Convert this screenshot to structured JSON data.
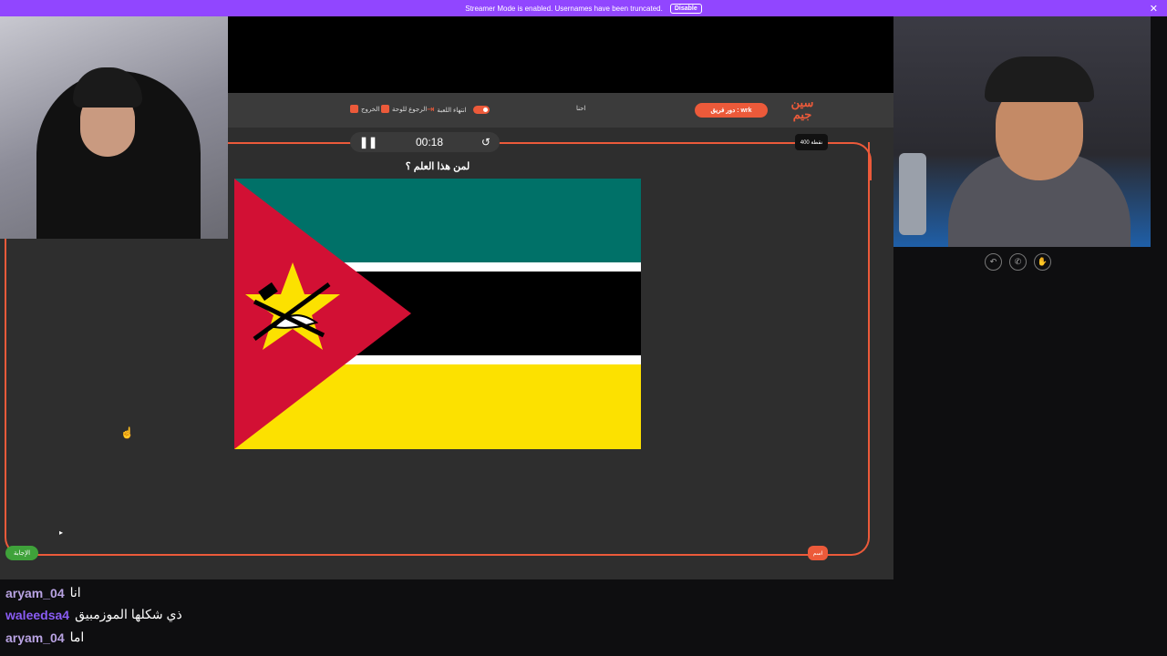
{
  "banner": {
    "text": "Streamer Mode is enabled. Usernames have been truncated.",
    "disable_label": "Disable",
    "close": "✕"
  },
  "gamebar": {
    "exit_label": "الخروج",
    "board_label": "الرجوع للوحة",
    "end_game_label": "انتهاء اللعبة",
    "center_label": "احنا",
    "team_turn_label": "دور فريق : wrk",
    "logo": "سين جيم"
  },
  "timer": {
    "time": "00:18"
  },
  "points": "400 نقطة",
  "question": "لمن هذا العلم ؟",
  "flag": {
    "colors": {
      "green": "#007168",
      "white": "#ffffff",
      "black": "#000000",
      "yellow": "#fce100",
      "red": "#d21034",
      "star": "#fce100"
    }
  },
  "answer_button": "الإجابة",
  "orange_button": "اسم",
  "chat": [
    {
      "user": "aryam_04",
      "text": "انا",
      "color": "#b9a3e3"
    },
    {
      "user": "waleedsa4",
      "text": "ذي شكلها الموزمبيق",
      "color": "#8a5cf5"
    },
    {
      "user": "aryam_04",
      "text": "اما",
      "color": "#b9a3e3"
    }
  ]
}
